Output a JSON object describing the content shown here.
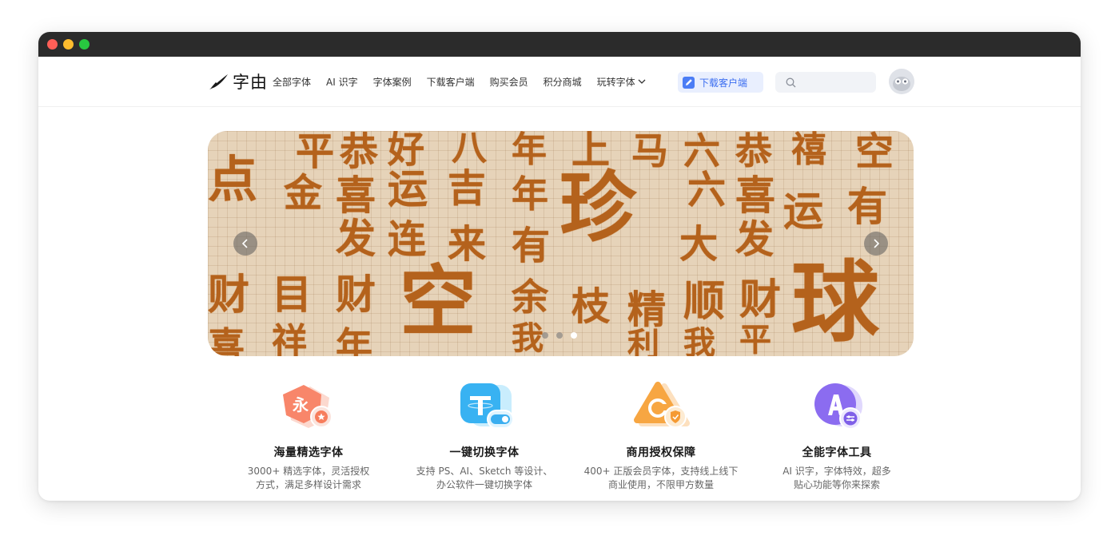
{
  "window": {
    "traffic_lights": [
      "close",
      "minimize",
      "maximize"
    ]
  },
  "header": {
    "logo_text": "字由",
    "nav": [
      {
        "label": "全部字体"
      },
      {
        "label": "AI 识字"
      },
      {
        "label": "字体案例"
      },
      {
        "label": "下载客户端"
      },
      {
        "label": "购买会员"
      },
      {
        "label": "积分商城"
      },
      {
        "label": "玩转字体",
        "has_dropdown": true
      }
    ],
    "download_button": "下载客户端",
    "search": {
      "placeholder": "",
      "icon": "search-icon"
    },
    "avatar_icon": "avatar"
  },
  "banner": {
    "glyphs": [
      "平",
      "恭",
      "好",
      "八",
      "年",
      "上",
      "马",
      "六",
      "恭",
      "禧",
      "空",
      "点",
      "金",
      "喜",
      "运",
      "吉",
      "年",
      "珍",
      "六",
      "喜",
      "运",
      "有",
      "发",
      "连",
      "来",
      "有",
      "大",
      "发",
      "财",
      "目",
      "财",
      "空",
      "余",
      "枝",
      "精",
      "顺",
      "财",
      "球",
      "喜",
      "祥",
      "年",
      "我",
      "利",
      "我",
      "平"
    ],
    "slides": 3,
    "active_slide": 2,
    "prev_icon": "chevron-left-icon",
    "next_icon": "chevron-right-icon"
  },
  "features": [
    {
      "title": "海量精选字体",
      "desc_line1": "3000+ 精选字体，灵活授权",
      "desc_line2": "方式，满足多样设计需求",
      "icon_char": "永",
      "colors": [
        "#f8866a",
        "#fbd8cf"
      ]
    },
    {
      "title": "一键切换字体",
      "desc_line1": "支持 PS、AI、Sketch 等设计、",
      "desc_line2": "办公软件一键切换字体",
      "icon_char": "T",
      "colors": [
        "#3cb6f3",
        "#c5ecfd"
      ]
    },
    {
      "title": "商用授权保障",
      "desc_line1": "400+ 正版会员字体，支持线上线下",
      "desc_line2": "商业使用，不限甲方数量",
      "icon_char": "C",
      "colors": [
        "#f7a642",
        "#fde2c2"
      ]
    },
    {
      "title": "全能字体工具",
      "desc_line1": "AI 识字，字体特效，超多",
      "desc_line2": "贴心功能等你来探索",
      "icon_char": "A",
      "colors": [
        "#8b6cf0",
        "#ddd4fd"
      ]
    }
  ]
}
